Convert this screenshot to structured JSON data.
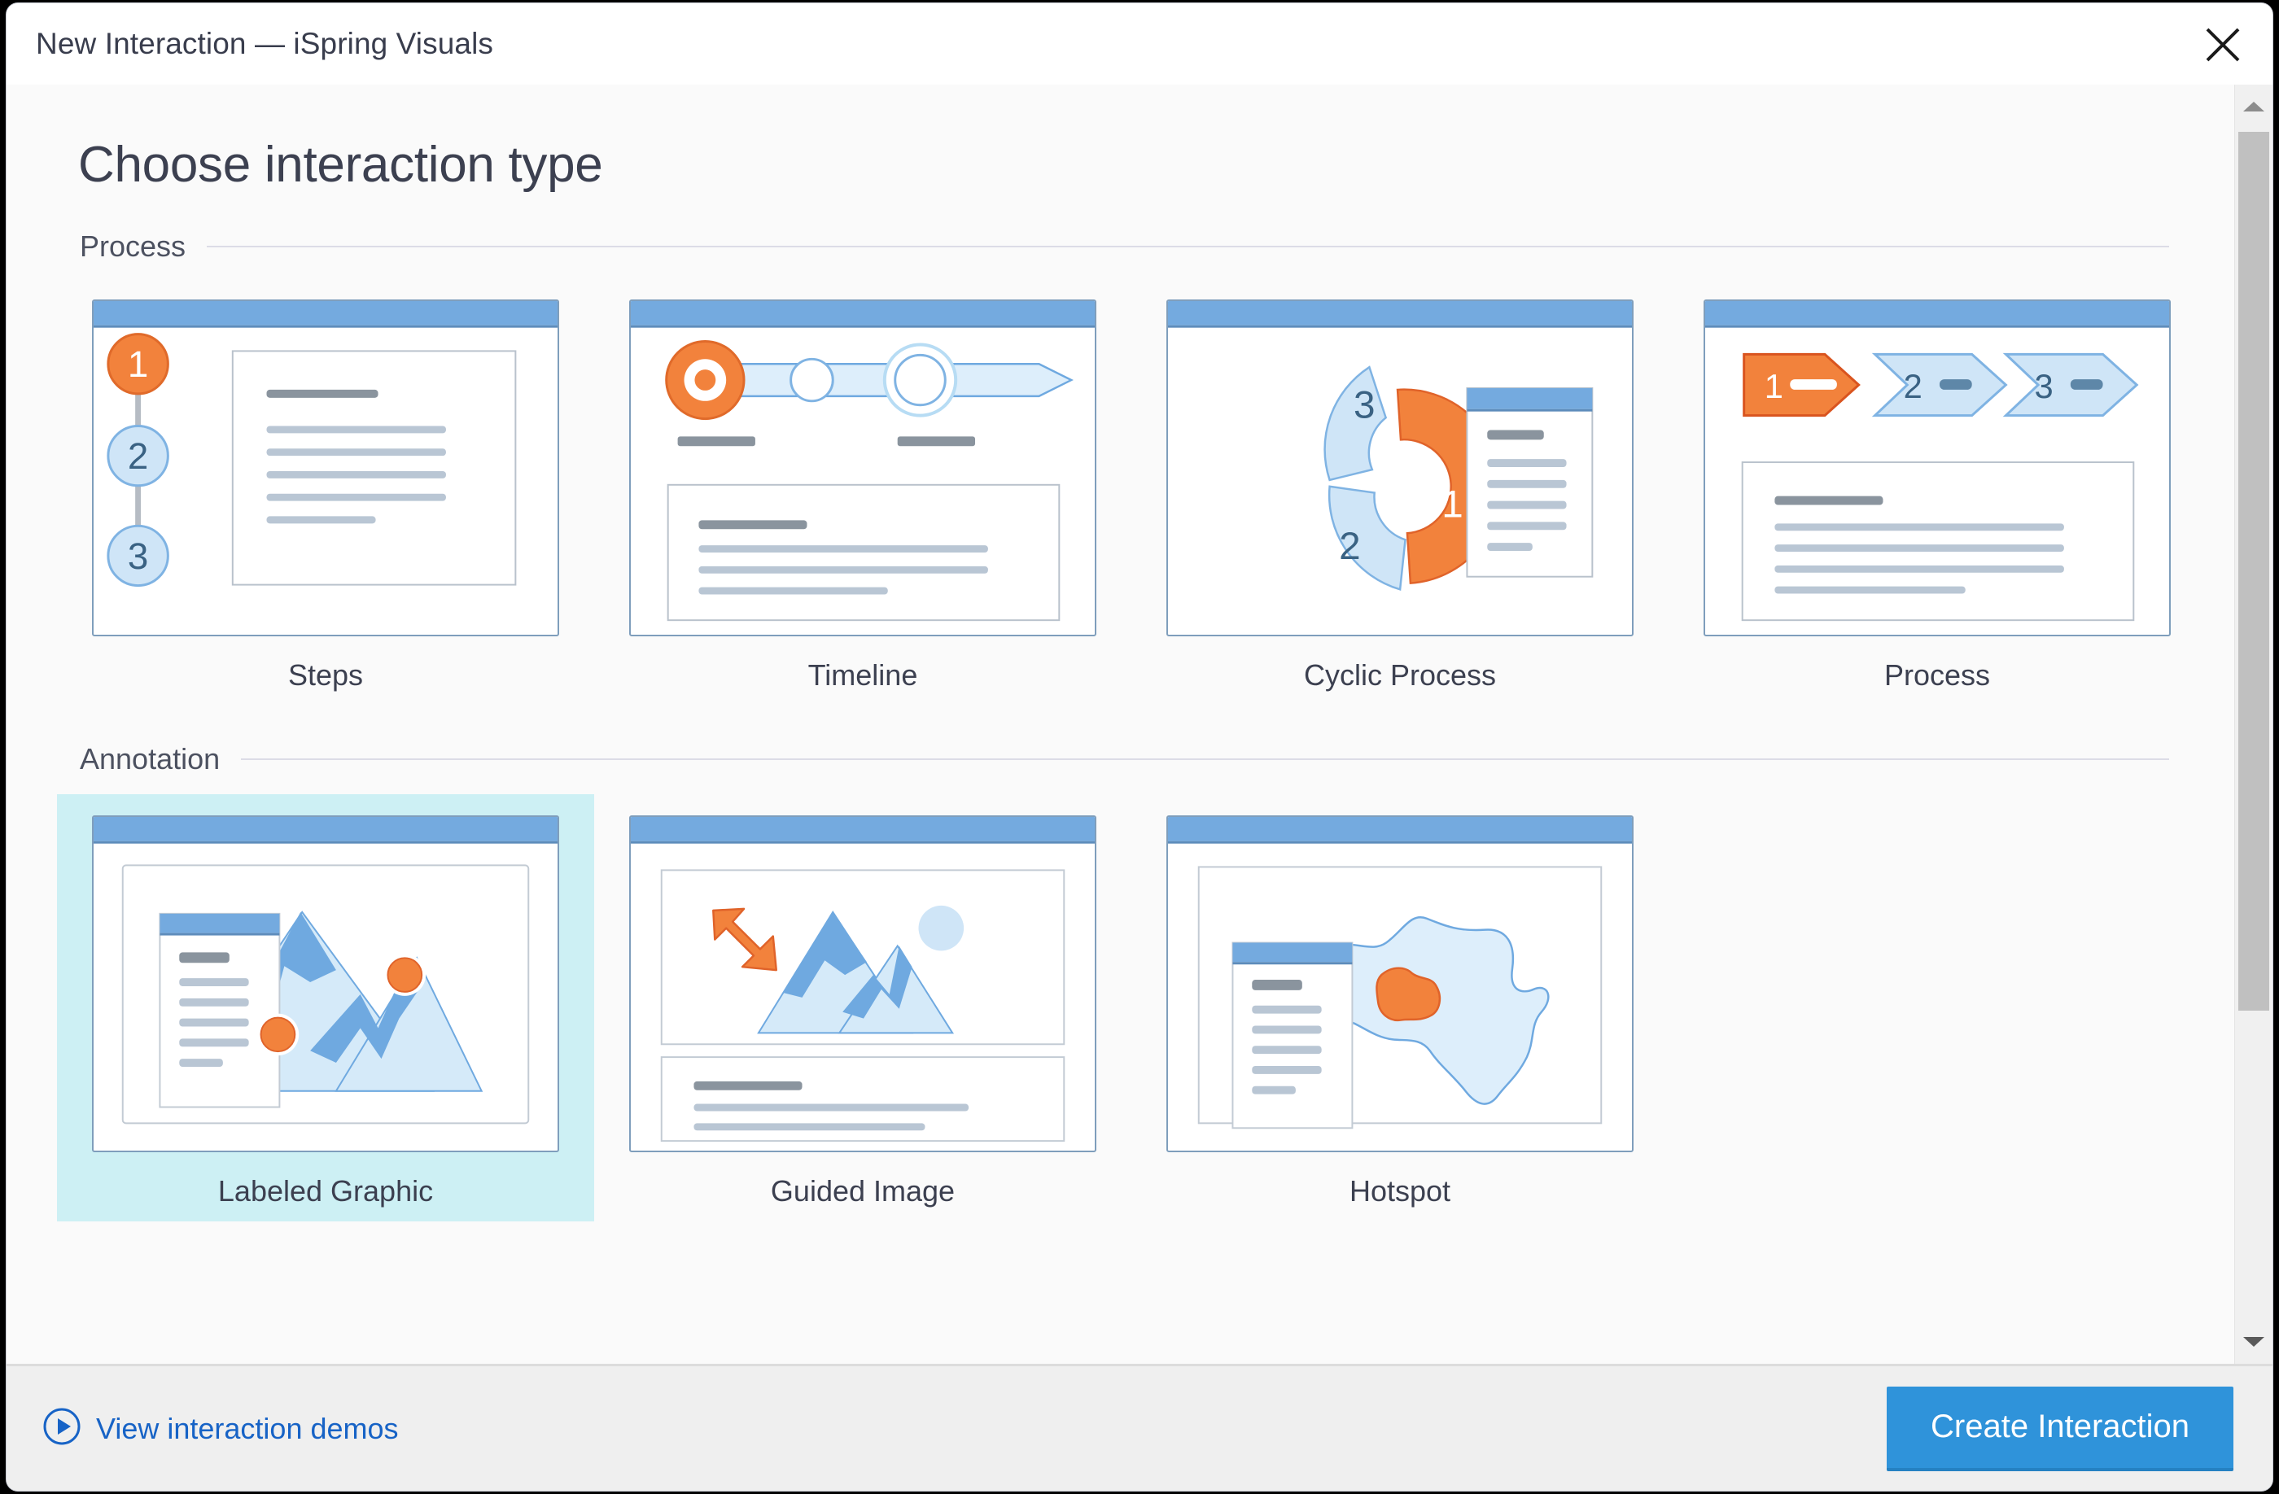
{
  "window": {
    "title": "New Interaction — iSpring Visuals",
    "close_icon": "close-icon"
  },
  "page": {
    "heading": "Choose interaction type"
  },
  "sections": [
    {
      "label": "Process",
      "cards": [
        {
          "label": "Steps",
          "thumb": "steps",
          "selected": false
        },
        {
          "label": "Timeline",
          "thumb": "timeline",
          "selected": false
        },
        {
          "label": "Cyclic Process",
          "thumb": "cyclic",
          "selected": false
        },
        {
          "label": "Process",
          "thumb": "process",
          "selected": false
        }
      ]
    },
    {
      "label": "Annotation",
      "cards": [
        {
          "label": "Labeled Graphic",
          "thumb": "labeled",
          "selected": true
        },
        {
          "label": "Guided Image",
          "thumb": "guided",
          "selected": false
        },
        {
          "label": "Hotspot",
          "thumb": "hotspot",
          "selected": false
        }
      ]
    }
  ],
  "thumb_numbers": {
    "steps": [
      "1",
      "2",
      "3"
    ],
    "cyclic": [
      "1",
      "2",
      "3"
    ],
    "process": [
      "1",
      "2",
      "3"
    ]
  },
  "scrollbar": {
    "up_icon": "chevron-up-icon",
    "down_icon": "chevron-down-icon"
  },
  "footer": {
    "demos_icon": "play-circle-icon",
    "demos_label": "View interaction demos",
    "create_label": "Create Interaction"
  },
  "colors": {
    "accent_blue": "#2f93da",
    "link_blue": "#1763c6",
    "selection": "#cdf0f4",
    "orange": "#f2823c",
    "thumb_blue": "#74aadf",
    "light_blue": "#cfe5f7",
    "frame_border": "#7f9ebc"
  }
}
